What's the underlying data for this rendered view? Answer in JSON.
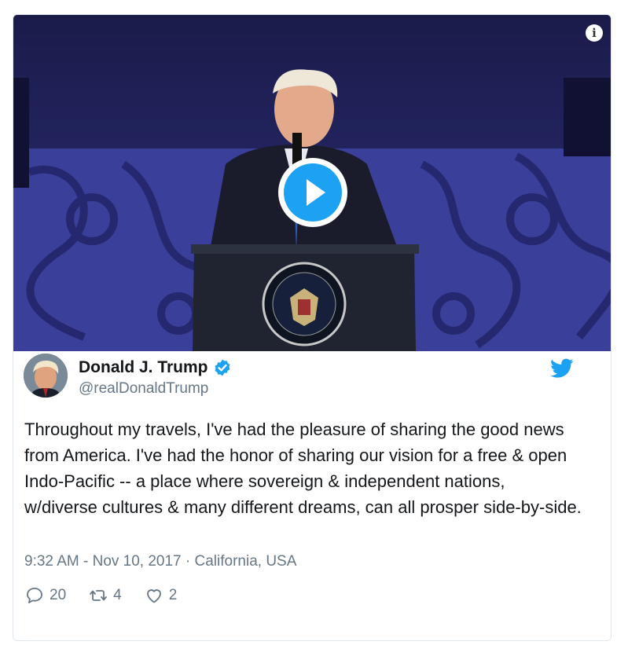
{
  "tweet": {
    "display_name": "Donald J. Trump",
    "handle": "@realDonaldTrump",
    "text": "Throughout my travels, I've had the pleasure of sharing the good news from America. I've had the honor of sharing our vision for a free & open Indo-Pacific -- a place where sovereign & independent nations, w/diverse cultures & many different dreams, can all prosper side-by-side.",
    "time": "9:32 AM - Nov 10, 2017",
    "separator": " · ",
    "location": "California, USA",
    "replies": "20",
    "retweets": "4",
    "likes": "2"
  },
  "media": {
    "info_glyph": "i",
    "play_icon": "play-icon"
  },
  "colors": {
    "accent": "#1da1f2",
    "muted": "#657786",
    "text": "#14171a",
    "border": "#e1e8ed"
  }
}
